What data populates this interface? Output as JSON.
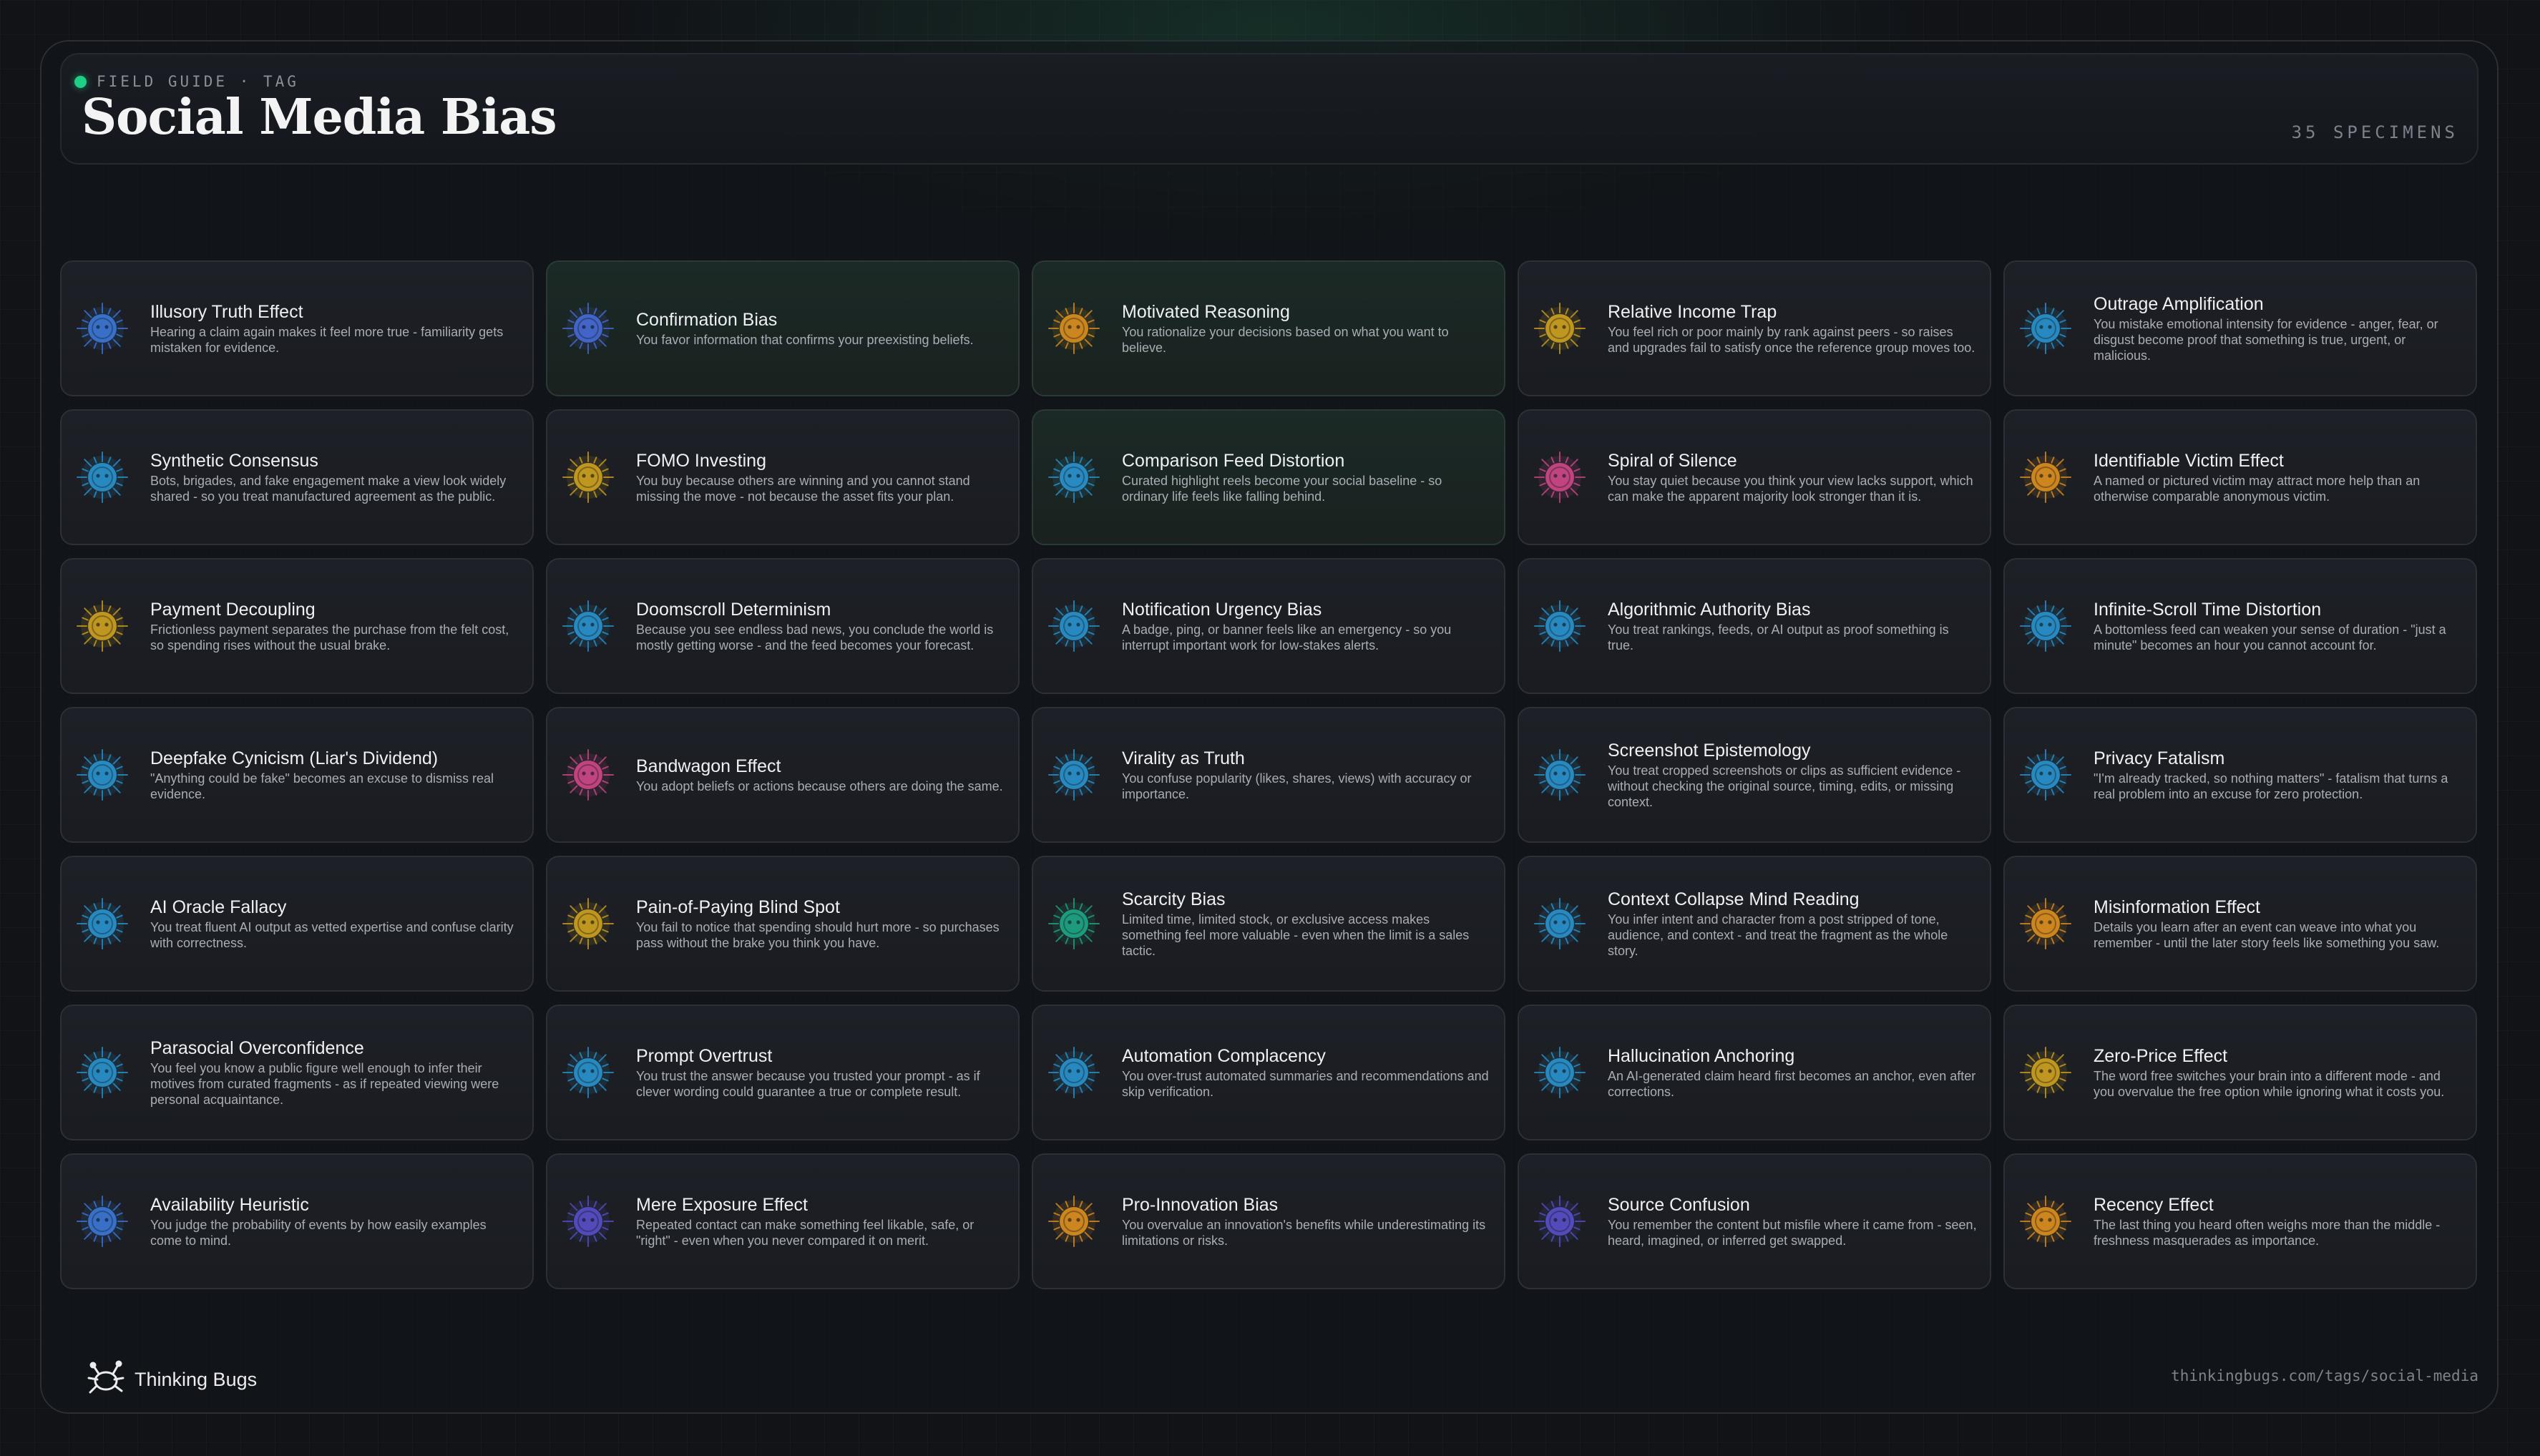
{
  "header": {
    "eyebrow": "FIELD GUIDE · TAG",
    "title": "Social Media Bias",
    "count": "35 SPECIMENS",
    "accent_color": "#1fcf86"
  },
  "cards": [
    {
      "name": "Illusory Truth Effect",
      "desc": "Hearing a claim again makes it feel more true - familiarity gets mistaken for evidence.",
      "color": "#3d7ce0",
      "icon": "bug-icon"
    },
    {
      "name": "Confirmation Bias",
      "desc": "You favor information that confirms your preexisting beliefs.",
      "color": "#4a6fe0",
      "icon": "bug-icon"
    },
    {
      "name": "Motivated Reasoning",
      "desc": "You rationalize your decisions based on what you want to believe.",
      "color": "#e8951f",
      "icon": "bug-icon"
    },
    {
      "name": "Relative Income Trap",
      "desc": "You feel rich or poor mainly by rank against peers - so raises and upgrades fail to satisfy once the reference group moves too.",
      "color": "#d8a820",
      "icon": "bug-icon"
    },
    {
      "name": "Outrage Amplification",
      "desc": "You mistake emotional intensity for evidence - anger, fear, or disgust become proof that something is true, urgent, or malicious.",
      "color": "#2a9ad8",
      "icon": "bug-icon"
    },
    {
      "name": "Synthetic Consensus",
      "desc": "Bots, brigades, and fake engagement make a view look widely shared - so you treat manufactured agreement as the public.",
      "color": "#2a9ad8",
      "icon": "bug-icon"
    },
    {
      "name": "FOMO Investing",
      "desc": "You buy because others are winning and you cannot stand missing the move - not because the asset fits your plan.",
      "color": "#d8a820",
      "icon": "bug-icon"
    },
    {
      "name": "Comparison Feed Distortion",
      "desc": "Curated highlight reels become your social baseline - so ordinary life feels like falling behind.",
      "color": "#2a9ad8",
      "icon": "bug-icon"
    },
    {
      "name": "Spiral of Silence",
      "desc": "You stay quiet because you think your view lacks support, which can make the apparent majority look stronger than it is.",
      "color": "#d84a8e",
      "icon": "bug-icon"
    },
    {
      "name": "Identifiable Victim Effect",
      "desc": "A named or pictured victim may attract more help than an otherwise comparable anonymous victim.",
      "color": "#e8951f",
      "icon": "bug-icon"
    },
    {
      "name": "Payment Decoupling",
      "desc": "Frictionless payment separates the purchase from the felt cost, so spending rises without the usual brake.",
      "color": "#d8a820",
      "icon": "bug-icon"
    },
    {
      "name": "Doomscroll Determinism",
      "desc": "Because you see endless bad news, you conclude the world is mostly getting worse - and the feed becomes your forecast.",
      "color": "#2a9ad8",
      "icon": "bug-icon"
    },
    {
      "name": "Notification Urgency Bias",
      "desc": "A badge, ping, or banner feels like an emergency - so you interrupt important work for low-stakes alerts.",
      "color": "#2a9ad8",
      "icon": "bug-icon"
    },
    {
      "name": "Algorithmic Authority Bias",
      "desc": "You treat rankings, feeds, or AI output as proof something is true.",
      "color": "#2a9ad8",
      "icon": "bug-icon"
    },
    {
      "name": "Infinite-Scroll Time Distortion",
      "desc": "A bottomless feed can weaken your sense of duration - \"just a minute\" becomes an hour you cannot account for.",
      "color": "#2a9ad8",
      "icon": "bug-icon"
    },
    {
      "name": "Deepfake Cynicism (Liar's Dividend)",
      "desc": "\"Anything could be fake\" becomes an excuse to dismiss real evidence.",
      "color": "#2a9ad8",
      "icon": "bug-icon"
    },
    {
      "name": "Bandwagon Effect",
      "desc": "You adopt beliefs or actions because others are doing the same.",
      "color": "#d84a8e",
      "icon": "bug-icon"
    },
    {
      "name": "Virality as Truth",
      "desc": "You confuse popularity (likes, shares, views) with accuracy or importance.",
      "color": "#2a9ad8",
      "icon": "bug-icon"
    },
    {
      "name": "Screenshot Epistemology",
      "desc": "You treat cropped screenshots or clips as sufficient evidence - without checking the original source, timing, edits, or missing context.",
      "color": "#2a9ad8",
      "icon": "bug-icon"
    },
    {
      "name": "Privacy Fatalism",
      "desc": "\"I'm already tracked, so nothing matters\" - fatalism that turns a real problem into an excuse for zero protection.",
      "color": "#2a9ad8",
      "icon": "bug-icon"
    },
    {
      "name": "AI Oracle Fallacy",
      "desc": "You treat fluent AI output as vetted expertise and confuse clarity with correctness.",
      "color": "#2a9ad8",
      "icon": "bug-icon"
    },
    {
      "name": "Pain-of-Paying Blind Spot",
      "desc": "You fail to notice that spending should hurt more - so purchases pass without the brake you think you have.",
      "color": "#d8a820",
      "icon": "bug-icon"
    },
    {
      "name": "Scarcity Bias",
      "desc": "Limited time, limited stock, or exclusive access makes something feel more valuable - even when the limit is a sales tactic.",
      "color": "#1fae8a",
      "icon": "bug-icon"
    },
    {
      "name": "Context Collapse Mind Reading",
      "desc": "You infer intent and character from a post stripped of tone, audience, and context - and treat the fragment as the whole story.",
      "color": "#2a9ad8",
      "icon": "bug-icon"
    },
    {
      "name": "Misinformation Effect",
      "desc": "Details you learn after an event can weave into what you remember - until the later story feels like something you saw.",
      "color": "#e8951f",
      "icon": "bug-icon"
    },
    {
      "name": "Parasocial Overconfidence",
      "desc": "You feel you know a public figure well enough to infer their motives from curated fragments - as if repeated viewing were personal acquaintance.",
      "color": "#2a9ad8",
      "icon": "bug-icon"
    },
    {
      "name": "Prompt Overtrust",
      "desc": "You trust the answer because you trusted your prompt - as if clever wording could guarantee a true or complete result.",
      "color": "#2a9ad8",
      "icon": "bug-icon"
    },
    {
      "name": "Automation Complacency",
      "desc": "You over-trust automated summaries and recommendations and skip verification.",
      "color": "#2a9ad8",
      "icon": "bug-icon"
    },
    {
      "name": "Hallucination Anchoring",
      "desc": "An AI-generated claim heard first becomes an anchor, even after corrections.",
      "color": "#2a9ad8",
      "icon": "bug-icon"
    },
    {
      "name": "Zero-Price Effect",
      "desc": "The word free switches your brain into a different mode - and you overvalue the free option while ignoring what it costs you.",
      "color": "#d8a820",
      "icon": "bug-icon"
    },
    {
      "name": "Availability Heuristic",
      "desc": "You judge the probability of events by how easily examples come to mind.",
      "color": "#3d7ce0",
      "icon": "bug-icon"
    },
    {
      "name": "Mere Exposure Effect",
      "desc": "Repeated contact can make something feel likable, safe, or \"right\" - even when you never compared it on merit.",
      "color": "#5a52d0",
      "icon": "bug-icon"
    },
    {
      "name": "Pro-Innovation Bias",
      "desc": "You overvalue an innovation's benefits while underestimating its limitations or risks.",
      "color": "#e8951f",
      "icon": "bug-icon"
    },
    {
      "name": "Source Confusion",
      "desc": "You remember the content but misfile where it came from - seen, heard, imagined, or inferred get swapped.",
      "color": "#5a52d0",
      "icon": "bug-icon"
    },
    {
      "name": "Recency Effect",
      "desc": "The last thing you heard often weighs more than the middle - freshness masquerades as importance.",
      "color": "#e8951f",
      "icon": "bug-icon"
    }
  ],
  "footer": {
    "brand": "Thinking Bugs",
    "url": "thinkingbugs.com/tags/social-media"
  }
}
